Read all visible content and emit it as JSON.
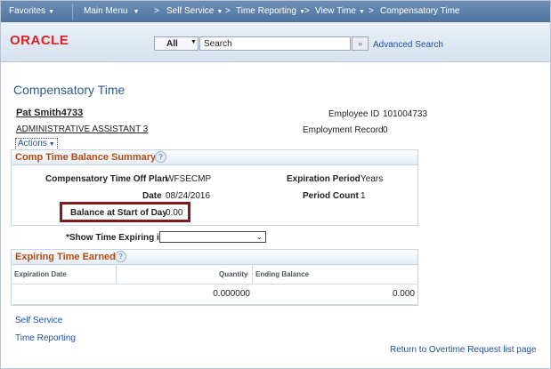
{
  "nav": {
    "favorites": "Favorites",
    "main_menu": "Main Menu",
    "crumb_sep": ">",
    "self_service": "Self Service",
    "time_reporting": "Time Reporting",
    "view_time": "View Time",
    "current": "Compensatory Time"
  },
  "header": {
    "logo": "ORACLE",
    "search_scope": "All",
    "search_placeholder": "Search",
    "search_go": "»",
    "advanced_search": "Advanced Search"
  },
  "page": {
    "title": "Compensatory Time",
    "employee_name": "Pat Smith4733",
    "job_title": "ADMINISTRATIVE ASSISTANT 3",
    "actions": "Actions",
    "employee_id_label": "Employee ID",
    "employee_id": "101004733",
    "employment_record_label": "Employment Record",
    "employment_record": "0"
  },
  "summary": {
    "title": "Comp Time Balance Summary",
    "plan_label": "Compensatory Time Off Plan",
    "plan_value": "WFSECMP",
    "date_label": "Date",
    "date_value": "08/24/2016",
    "balance_label": "Balance at Start of Day",
    "balance_value": "0.00",
    "expiration_period_label": "Expiration Period",
    "expiration_period_value": "Years",
    "period_count_label": "Period Count",
    "period_count_value": "1"
  },
  "show_expiring": {
    "label": "*Show Time Expiring in",
    "value": ""
  },
  "expiring": {
    "title": "Expiring Time Earned",
    "columns": [
      "Expiration Date",
      "Quantity",
      "Ending Balance"
    ],
    "rows": [
      {
        "expiration_date": "",
        "quantity": "0.000000",
        "ending_balance": "0.000"
      }
    ]
  },
  "footer": {
    "self_service": "Self Service",
    "time_reporting": "Time Reporting",
    "return_link": "Return to Overtime Request list page"
  },
  "colors": {
    "nav_bar": "#5a7ea9",
    "group_title": "#b24c14",
    "link": "#1d4f9c",
    "highlight": "#7d1d1d",
    "logo": "#e02020"
  }
}
